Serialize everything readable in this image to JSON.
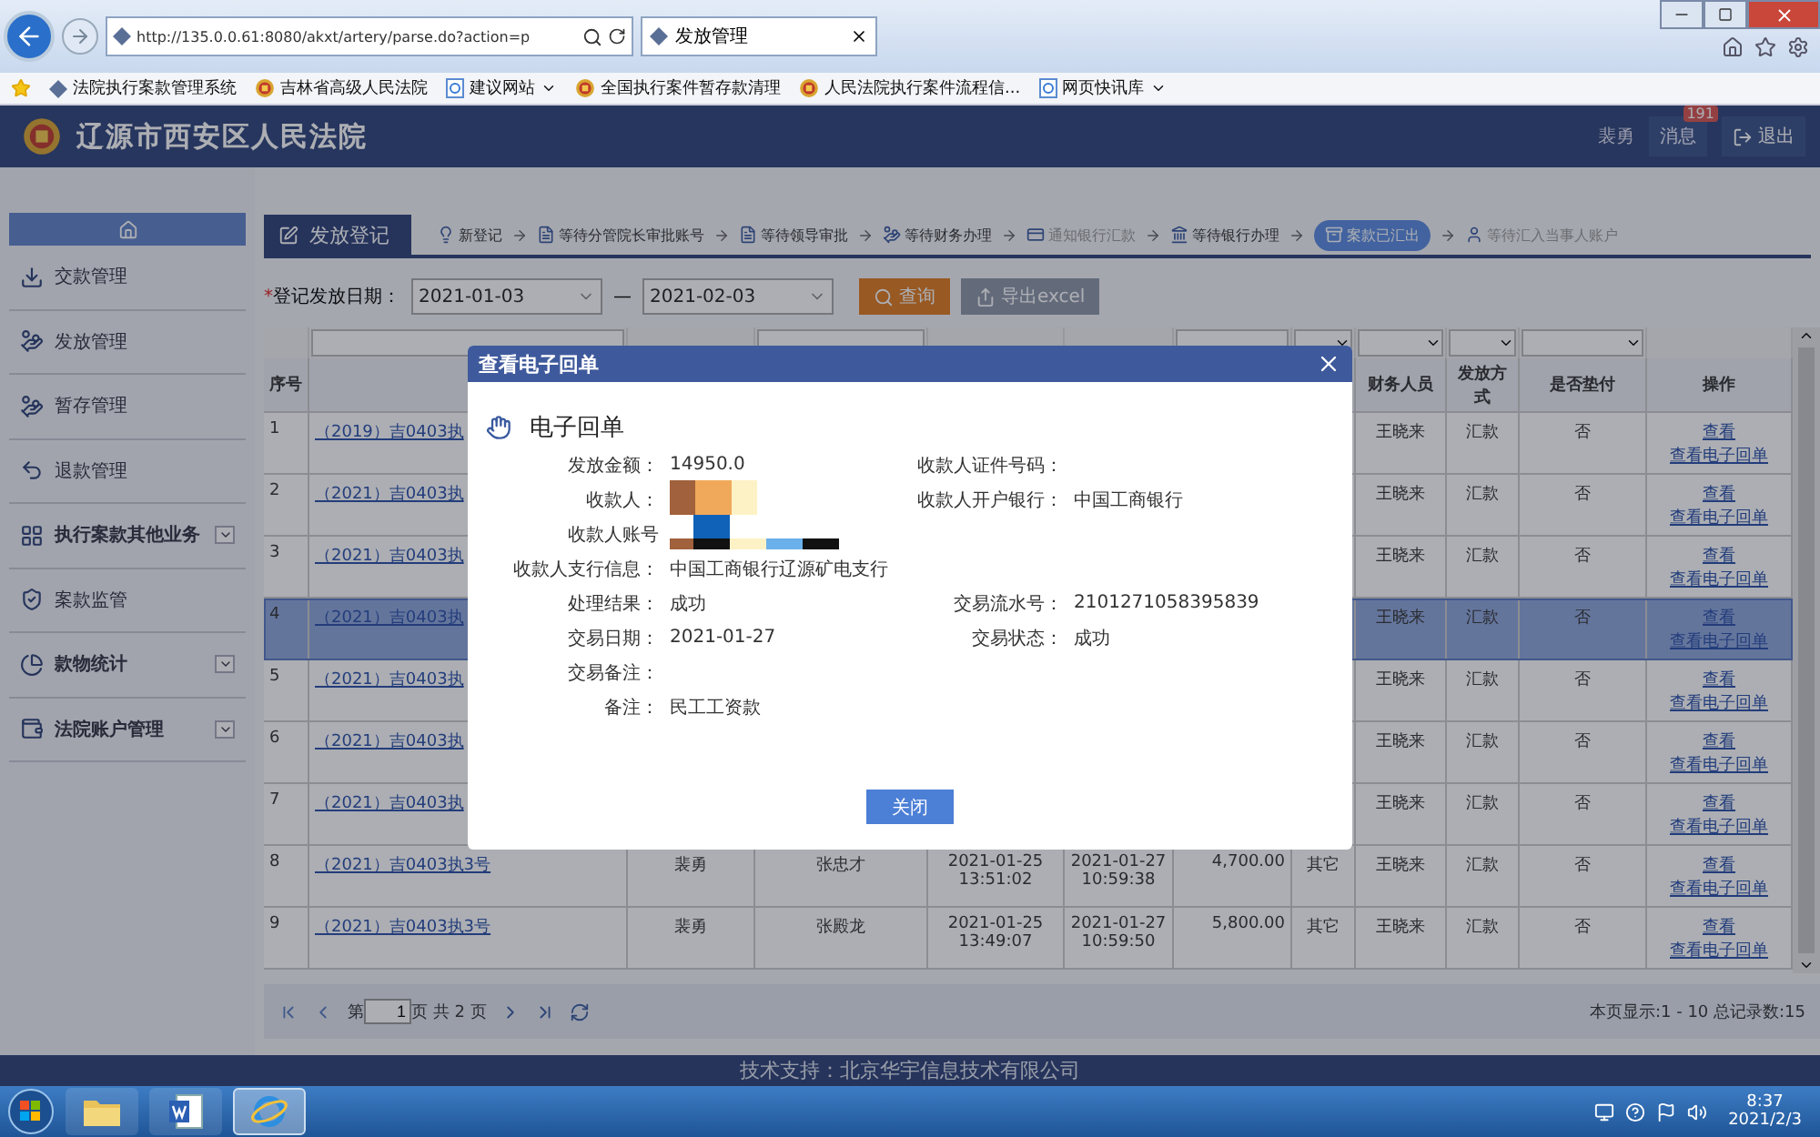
{
  "browser": {
    "address": "http://135.0.0.61:8080/akxt/artery/parse.do?action=p",
    "tab": "发放管理",
    "favorites": [
      {
        "label": "法院执行案款管理系统",
        "kind": "site",
        "dropdown": false
      },
      {
        "label": "吉林省高级人民法院",
        "kind": "court",
        "dropdown": false
      },
      {
        "label": "建议网站",
        "kind": "page",
        "dropdown": true
      },
      {
        "label": "全国执行案件暂存款清理",
        "kind": "court",
        "dropdown": false
      },
      {
        "label": "人民法院执行案件流程信...",
        "kind": "court",
        "dropdown": false
      },
      {
        "label": "网页快讯库",
        "kind": "page",
        "dropdown": true
      }
    ]
  },
  "header": {
    "title": "辽源市西安区人民法院",
    "user": "裴勇",
    "messages": "消息",
    "message_count": "191",
    "logout": "退出"
  },
  "sidebar": {
    "items": [
      {
        "label": "交款管理",
        "kind": "link"
      },
      {
        "label": "发放管理",
        "kind": "link"
      },
      {
        "label": "暂存管理",
        "kind": "link"
      },
      {
        "label": "退款管理",
        "kind": "link"
      },
      {
        "label": "执行案款其他业务",
        "kind": "group"
      },
      {
        "label": "案款监管",
        "kind": "link"
      },
      {
        "label": "款物统计",
        "kind": "group"
      },
      {
        "label": "法院账户管理",
        "kind": "group"
      }
    ]
  },
  "page_tab": "发放登记",
  "steps": [
    {
      "label": "新登记",
      "selected": false,
      "disabled": false
    },
    {
      "label": "等待分管院长审批账号",
      "selected": false,
      "disabled": false
    },
    {
      "label": "等待领导审批",
      "selected": false,
      "disabled": false
    },
    {
      "label": "等待财务办理",
      "selected": false,
      "disabled": false
    },
    {
      "label": "通知银行汇款",
      "selected": false,
      "disabled": true
    },
    {
      "label": "等待银行办理",
      "selected": false,
      "disabled": false
    },
    {
      "label": "案款已汇出",
      "selected": true,
      "disabled": false
    },
    {
      "label": "等待汇入当事人账户",
      "selected": false,
      "disabled": true
    }
  ],
  "filter": {
    "required_mark": "*",
    "label": "登记发放日期：",
    "date_from": "2021-01-03",
    "separator": "—",
    "date_to": "2021-02-03",
    "search_button": "查询",
    "export_button": "导出excel"
  },
  "table": {
    "headers": {
      "no": "序号",
      "finance": "财务人员",
      "method": "发放方式",
      "advance": "是否垫付",
      "actions": "操作"
    },
    "rows": [
      {
        "no": "1",
        "case": "（2019）吉0403执",
        "finance": "王晓来",
        "method": "汇款",
        "advance": "否",
        "actions": [
          "查看",
          "查看电子回单"
        ],
        "selected": false
      },
      {
        "no": "2",
        "case": "（2021）吉0403执",
        "finance": "王晓来",
        "method": "汇款",
        "advance": "否",
        "actions": [
          "查看",
          "查看电子回单"
        ],
        "selected": false
      },
      {
        "no": "3",
        "case": "（2021）吉0403执",
        "finance": "王晓来",
        "method": "汇款",
        "advance": "否",
        "actions": [
          "查看",
          "查看电子回单"
        ],
        "selected": false
      },
      {
        "no": "4",
        "case": "（2021）吉0403执",
        "finance": "王晓来",
        "method": "汇款",
        "advance": "否",
        "actions": [
          "查看",
          "查看电子回单"
        ],
        "selected": true
      },
      {
        "no": "5",
        "case": "（2021）吉0403执",
        "finance": "王晓来",
        "method": "汇款",
        "advance": "否",
        "actions": [
          "查看",
          "查看电子回单"
        ],
        "selected": false
      },
      {
        "no": "6",
        "case": "（2021）吉0403执",
        "finance": "王晓来",
        "method": "汇款",
        "advance": "否",
        "actions": [
          "查看",
          "查看电子回单"
        ],
        "selected": false
      },
      {
        "no": "7",
        "case": "（2021）吉0403执",
        "finance": "王晓来",
        "method": "汇款",
        "advance": "否",
        "actions": [
          "查看",
          "查看电子回单"
        ],
        "selected": false
      },
      {
        "no": "8",
        "case": "（2021）吉0403执3号",
        "applicant": "裴勇",
        "receiver": "张忠才",
        "reg_time": "2021-01-25 13:51:02",
        "send_time": "2021-01-27 10:59:38",
        "amount": "4,700.00",
        "type": "其它",
        "finance": "王晓来",
        "method": "汇款",
        "advance": "否",
        "actions": [
          "查看",
          "查看电子回单"
        ],
        "selected": false
      },
      {
        "no": "9",
        "case": "（2021）吉0403执3号",
        "applicant": "裴勇",
        "receiver": "张殿龙",
        "reg_time": "2021-01-25 13:49:07",
        "send_time": "2021-01-27 10:59:50",
        "amount": "5,800.00",
        "type": "其它",
        "finance": "王晓来",
        "method": "汇款",
        "advance": "否",
        "actions": [
          "查看",
          "查看电子回单"
        ],
        "selected": false
      }
    ]
  },
  "pagination": {
    "page_prefix": "第",
    "page": "1",
    "page_suffix": "页 共 2 页",
    "summary": "本页显示:1 - 10 总记录数:15"
  },
  "modal": {
    "title": "查看电子回单",
    "heading": "电子回单",
    "close_button": "关闭",
    "rows": [
      {
        "left": {
          "label": "发放金额：",
          "value": "14950.0"
        },
        "right": {
          "label": "收款人证件号码："
        }
      },
      {
        "left": {
          "label": "收款人：",
          "redacted": true
        },
        "right": {
          "label": "收款人开户银行：",
          "value": "中国工商银行"
        }
      },
      {
        "left": {
          "label": "收款人账号",
          "redacted": true
        }
      },
      {
        "left": {
          "label": "收款人支行信息：",
          "value": "中国工商银行辽源矿电支行"
        }
      },
      {
        "left": {
          "label": "处理结果：",
          "value": "成功"
        },
        "right": {
          "label": "交易流水号：",
          "value": "2101271058395839"
        }
      },
      {
        "left": {
          "label": "交易日期：",
          "value": "2021-01-27"
        },
        "right": {
          "label": "交易状态：",
          "value": "成功"
        }
      },
      {
        "left": {
          "label": "交易备注："
        }
      },
      {
        "left": {
          "label": "备注：",
          "value": "民工工资款"
        }
      }
    ]
  },
  "footer": "技术支持：北京华宇信息技术有限公司",
  "taskbar": {
    "apps": [
      {
        "kind": "explorer",
        "selected": false
      },
      {
        "kind": "word",
        "selected": false
      },
      {
        "kind": "ie",
        "selected": true
      }
    ],
    "time": "8:37",
    "date": "2021/2/3"
  }
}
